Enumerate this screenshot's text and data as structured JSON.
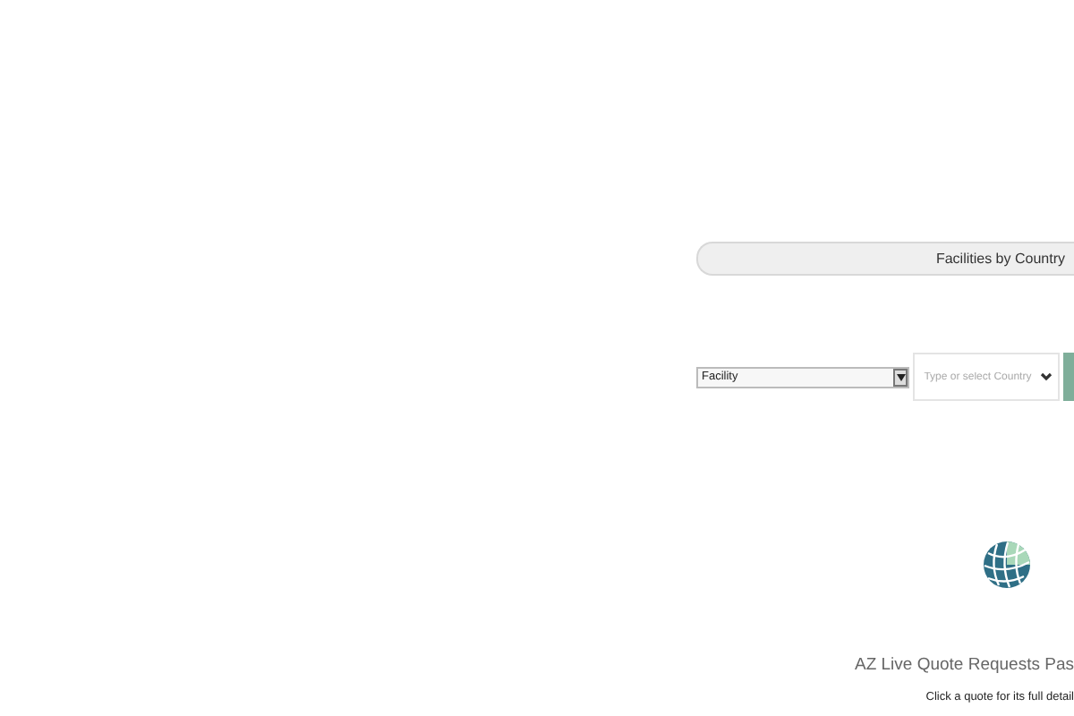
{
  "header": {
    "title": "Facilities by Country"
  },
  "filters": {
    "type_select": {
      "value": "Facility"
    },
    "country_field": {
      "placeholder": "Type or select Country"
    }
  },
  "quotes": {
    "title": "AZ Live Quote Requests Pas",
    "hint": "Click a quote for its full detail"
  }
}
